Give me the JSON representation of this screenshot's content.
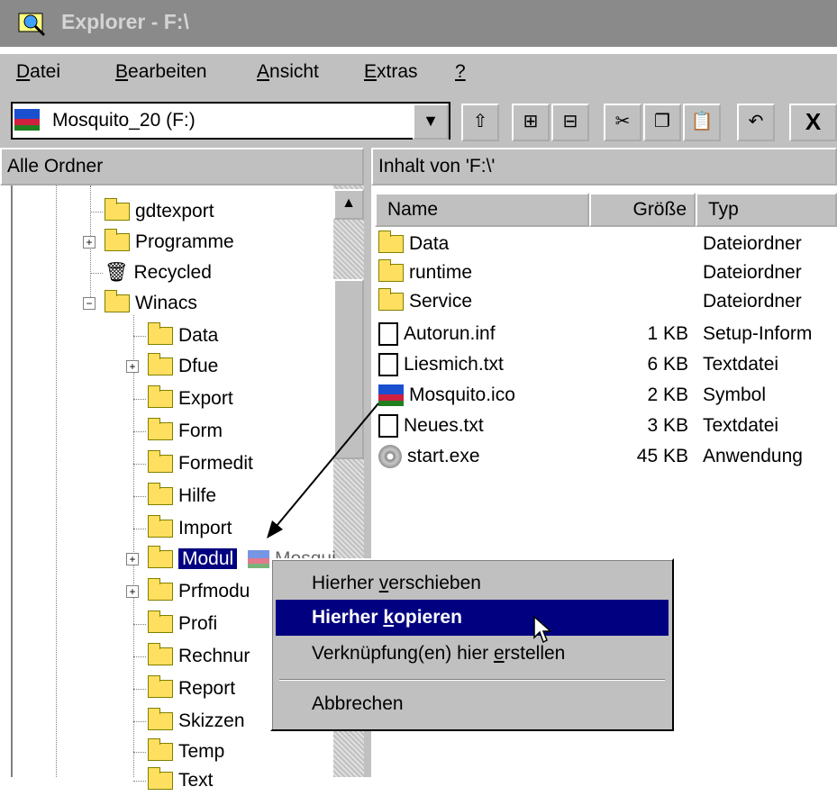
{
  "window": {
    "title": "Explorer - F:\\"
  },
  "menubar": {
    "items": [
      {
        "mnemonic": "D",
        "rest": "atei"
      },
      {
        "mnemonic": "B",
        "rest": "earbeiten"
      },
      {
        "mnemonic": "A",
        "rest": "nsicht"
      },
      {
        "mnemonic": "E",
        "rest": "xtras"
      },
      {
        "mnemonic": "?",
        "rest": ""
      }
    ]
  },
  "toolbar": {
    "drive": "Mosquito_20 (F:)",
    "undo_label": "↶",
    "delete_label": "X"
  },
  "tree_pane": {
    "header": "Alle Ordner"
  },
  "list_pane": {
    "header": "Inhalt von 'F:\\'",
    "columns": {
      "name": "Name",
      "size": "Größe",
      "type": "Typ"
    },
    "files": [
      {
        "name": "Data",
        "size": "",
        "type": "Dateiordner",
        "icon": "folder-icon"
      },
      {
        "name": "runtime",
        "size": "",
        "type": "Dateiordner",
        "icon": "folder-icon"
      },
      {
        "name": "Service",
        "size": "",
        "type": "Dateiordner",
        "icon": "folder-icon"
      },
      {
        "name": "Autorun.inf",
        "size": "1 KB",
        "type": "Setup-Inform",
        "icon": "setup-file-icon"
      },
      {
        "name": "Liesmich.txt",
        "size": "6 KB",
        "type": "Textdatei",
        "icon": "text-file-icon"
      },
      {
        "name": "Mosquito.ico",
        "size": "2 KB",
        "type": "Symbol",
        "icon": "image-icon"
      },
      {
        "name": "Neues.txt",
        "size": "3 KB",
        "type": "Textdatei",
        "icon": "text-file-icon"
      },
      {
        "name": "start.exe",
        "size": "45 KB",
        "type": "Anwendung",
        "icon": "cd-icon"
      }
    ]
  },
  "tree": {
    "items": [
      {
        "label": "gdtexport"
      },
      {
        "label": "Programme"
      },
      {
        "label": "Recycled"
      },
      {
        "label": "Winacs"
      },
      {
        "label": "Data"
      },
      {
        "label": "Dfue"
      },
      {
        "label": "Export"
      },
      {
        "label": "Form"
      },
      {
        "label": "Formedit"
      },
      {
        "label": "Hilfe"
      },
      {
        "label": "Import"
      },
      {
        "label": "Modul"
      },
      {
        "label": "Prfmodu"
      },
      {
        "label": "Profi"
      },
      {
        "label": "Rechnur"
      },
      {
        "label": "Report"
      },
      {
        "label": "Skizzen"
      },
      {
        "label": "Temp"
      },
      {
        "label": "Text"
      }
    ],
    "drag_ghost": "Mosqui"
  },
  "context_menu": {
    "move": {
      "before": "Hierher ",
      "mnemonic": "v",
      "after": "erschieben"
    },
    "copy": {
      "before": "Hierher ",
      "mnemonic": "k",
      "after": "opieren"
    },
    "link": {
      "before": "Verknüpfung(en) hier ",
      "mnemonic": "e",
      "after": "rstellen"
    },
    "cancel": "Abbrechen"
  }
}
